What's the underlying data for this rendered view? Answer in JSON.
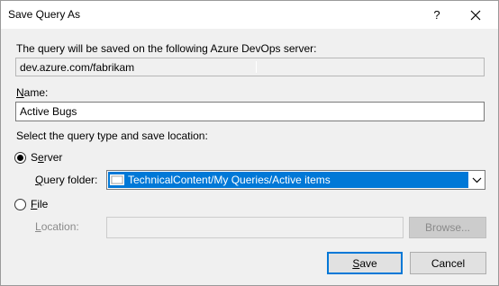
{
  "window": {
    "title": "Save Query As",
    "help_label": "?"
  },
  "server": {
    "description": "The query will be saved on the following Azure DevOps server:",
    "url": "dev.azure.com/fabrikam"
  },
  "name_field": {
    "label": "Name:",
    "value": "Active Bugs"
  },
  "location_section": {
    "instruction": "Select the query type and save location:",
    "server_option": {
      "label": "Server",
      "checked": true
    },
    "query_folder": {
      "label": "Query folder:",
      "value": "TechnicalContent/My Queries/Active items"
    },
    "file_option": {
      "label": "File",
      "checked": false
    },
    "location": {
      "label": "Location:",
      "value": ""
    },
    "browse_label": "Browse..."
  },
  "footer": {
    "save_label": "Save",
    "cancel_label": "Cancel"
  },
  "colors": {
    "selection": "#0078d7",
    "dialog_bg": "#f0f0f0"
  }
}
